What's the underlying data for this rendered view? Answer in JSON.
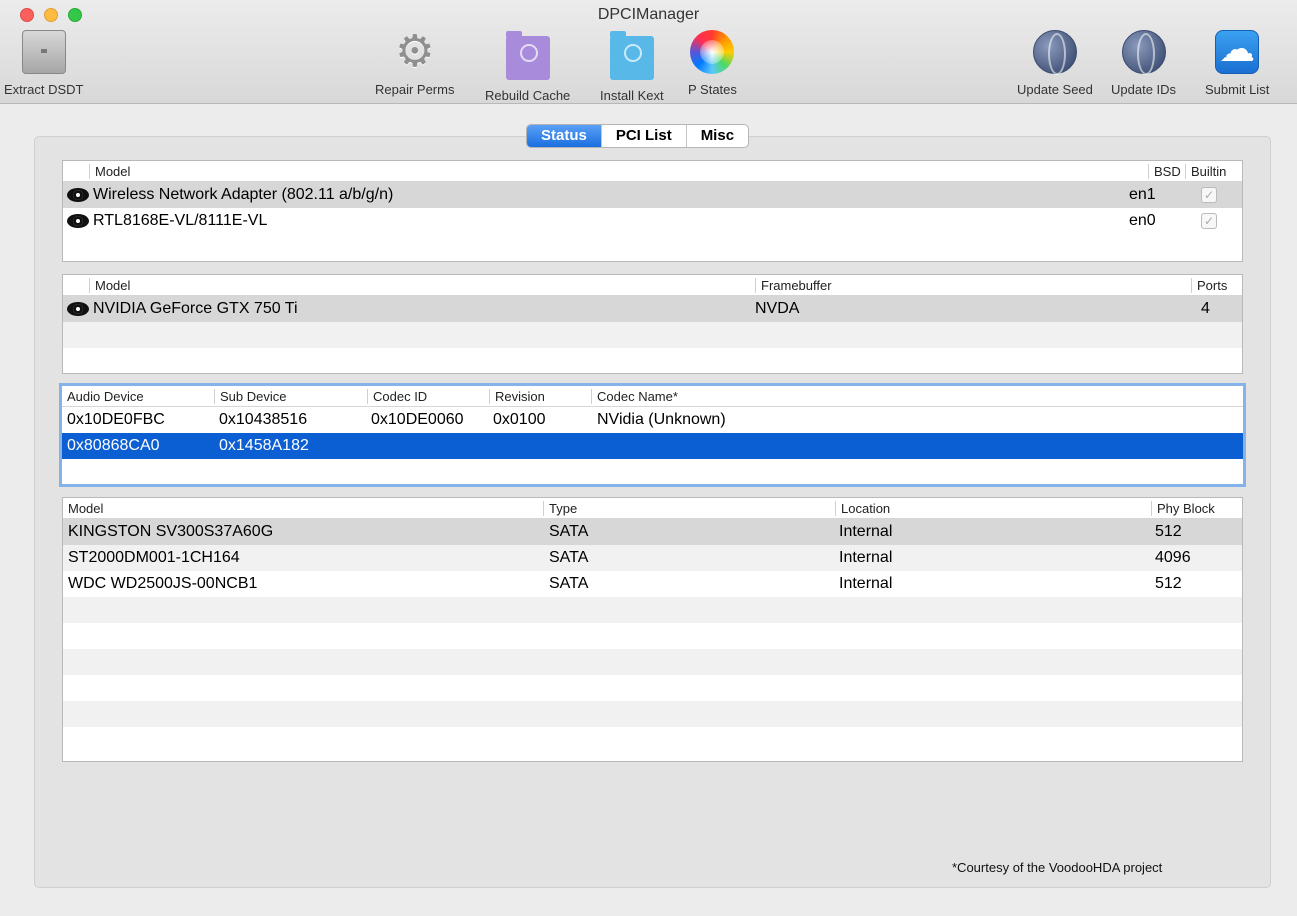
{
  "window": {
    "title": "DPCIManager"
  },
  "toolbar": {
    "extract_dsdt": "Extract DSDT",
    "repair_perms": "Repair Perms",
    "rebuild_cache": "Rebuild Cache",
    "install_kext": "Install Kext",
    "p_states": "P States",
    "update_seed": "Update Seed",
    "update_ids": "Update IDs",
    "submit_list": "Submit List"
  },
  "tabs": [
    "Status",
    "PCI List",
    "Misc"
  ],
  "network": {
    "headers": [
      "Model",
      "BSD",
      "Builtin"
    ],
    "rows": [
      {
        "model": "Wireless Network Adapter (802.11 a/b/g/n)",
        "bsd": "en1",
        "builtin": "✓"
      },
      {
        "model": "RTL8168E-VL/8111E-VL",
        "bsd": "en0",
        "builtin": "✓"
      }
    ]
  },
  "graphics": {
    "headers": [
      "Model",
      "Framebuffer",
      "Ports"
    ],
    "rows": [
      {
        "model": "NVIDIA GeForce GTX 750 Ti",
        "framebuffer": "NVDA",
        "ports": "4"
      }
    ]
  },
  "audio": {
    "headers": [
      "Audio Device",
      "Sub Device",
      "Codec ID",
      "Revision",
      "Codec Name*"
    ],
    "rows": [
      {
        "device": "0x10DE0FBC",
        "sub": "0x10438516",
        "codec_id": "0x10DE0060",
        "revision": "0x0100",
        "codec_name": "NVidia (Unknown)"
      },
      {
        "device": "0x80868CA0",
        "sub": "0x1458A182",
        "codec_id": "",
        "revision": "",
        "codec_name": ""
      }
    ]
  },
  "storage": {
    "headers": [
      "Model",
      "Type",
      "Location",
      "Phy Block"
    ],
    "rows": [
      {
        "model": "KINGSTON SV300S37A60G",
        "type": "SATA",
        "location": "Internal",
        "block": "512"
      },
      {
        "model": "ST2000DM001-1CH164",
        "type": "SATA",
        "location": "Internal",
        "block": "4096"
      },
      {
        "model": "WDC WD2500JS-00NCB1",
        "type": "SATA",
        "location": "Internal",
        "block": "512"
      }
    ]
  },
  "footer": {
    "note": "*Courtesy of the VoodooHDA project"
  },
  "icons": {
    "extract": "mac-pro-icon",
    "repair": "gear-icon",
    "rebuild": "folder-icon",
    "install": "folder-icon",
    "pstates": "color-wheel-icon",
    "seed": "globe-icon",
    "ids": "globe-icon",
    "submit": "cloud-icon",
    "row": "eye-icon"
  }
}
